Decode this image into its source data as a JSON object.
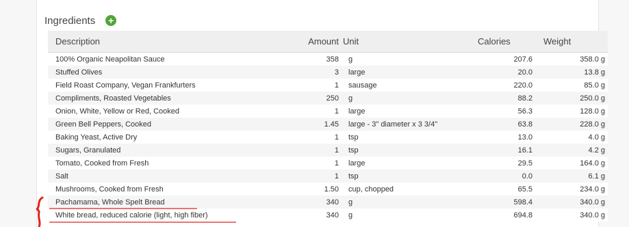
{
  "section": {
    "title": "Ingredients",
    "add_icon_glyph": "+",
    "add_icon": "plus-circle-icon",
    "accent_color": "#53a53a"
  },
  "table": {
    "headers": {
      "description": "Description",
      "amount": "Amount",
      "unit": "Unit",
      "calories": "Calories",
      "weight": "Weight"
    },
    "rows": [
      {
        "description": "100% Organic Neapolitan Sauce",
        "amount": "358",
        "unit": "g",
        "calories": "207.6",
        "weight": "358.0 g"
      },
      {
        "description": "Stuffed Olives",
        "amount": "3",
        "unit": "large",
        "calories": "20.0",
        "weight": "13.8 g"
      },
      {
        "description": "Field Roast Company, Vegan Frankfurters",
        "amount": "1",
        "unit": "sausage",
        "calories": "220.0",
        "weight": "85.0 g"
      },
      {
        "description": "Compliments, Roasted Vegetables",
        "amount": "250",
        "unit": "g",
        "calories": "88.2",
        "weight": "250.0 g"
      },
      {
        "description": "Onion, White, Yellow or Red, Cooked",
        "amount": "1",
        "unit": "large",
        "calories": "56.3",
        "weight": "128.0 g"
      },
      {
        "description": "Green Bell Peppers, Cooked",
        "amount": "1.45",
        "unit": "large - 3\" diameter x 3 3/4\"",
        "calories": "63.8",
        "weight": "228.0 g"
      },
      {
        "description": "Baking Yeast, Active Dry",
        "amount": "1",
        "unit": "tsp",
        "calories": "13.0",
        "weight": "4.0 g"
      },
      {
        "description": "Sugars, Granulated",
        "amount": "1",
        "unit": "tsp",
        "calories": "16.1",
        "weight": "4.2 g"
      },
      {
        "description": "Tomato, Cooked from Fresh",
        "amount": "1",
        "unit": "large",
        "calories": "29.5",
        "weight": "164.0 g"
      },
      {
        "description": "Salt",
        "amount": "1",
        "unit": "tsp",
        "calories": "0.0",
        "weight": "6.1 g"
      },
      {
        "description": "Mushrooms, Cooked from Fresh",
        "amount": "1.50",
        "unit": "cup, chopped",
        "calories": "65.5",
        "weight": "234.0 g"
      },
      {
        "description": "Pachamama, Whole Spelt Bread",
        "amount": "340",
        "unit": "g",
        "calories": "598.4",
        "weight": "340.0 g"
      },
      {
        "description": "White bread, reduced calorie (light, high fiber)",
        "amount": "340",
        "unit": "g",
        "calories": "694.8",
        "weight": "340.0 g"
      }
    ]
  },
  "annotation": {
    "color": "#e0231d"
  }
}
